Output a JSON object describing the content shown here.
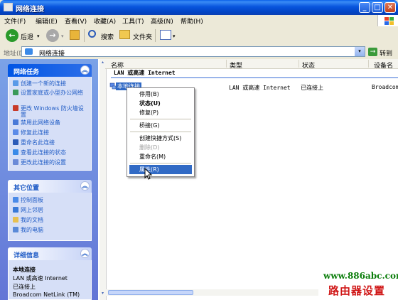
{
  "window": {
    "title": "网络连接"
  },
  "menu": [
    "文件(F)",
    "编辑(E)",
    "查看(V)",
    "收藏(A)",
    "工具(T)",
    "高级(N)",
    "帮助(H)"
  ],
  "toolbar": {
    "back": "后退",
    "search": "搜索",
    "folders": "文件夹"
  },
  "address": {
    "label": "地址(D)",
    "value": "网络连接",
    "go": "转到"
  },
  "task_pane": {
    "network_tasks": {
      "title": "网络任务",
      "items": [
        "创建一个新的连接",
        "设置家庭或小型办公网络",
        "更改 Windows 防火墙设置",
        "禁用此网络设备",
        "修复此连接",
        "重命名此连接",
        "查看此连接的状态",
        "更改此连接的设置"
      ]
    },
    "other_places": {
      "title": "其它位置",
      "items": [
        "控制面板",
        "网上邻居",
        "我的文档",
        "我的电脑"
      ]
    },
    "details": {
      "title": "详细信息",
      "lines": [
        "本地连接",
        "LAN 或高速 Internet",
        "已连接上",
        "Broadcom NetLink (TM)"
      ]
    }
  },
  "columns": [
    "名称",
    "类型",
    "状态",
    "设备名"
  ],
  "group_header": "LAN 或高速 Internet",
  "connection": {
    "name": "本地连接",
    "type": "LAN 或高速 Internet",
    "status": "已连接上",
    "device": "Broadcom"
  },
  "context_menu": [
    {
      "label": "停用(B)"
    },
    {
      "label": "状态(U)",
      "bold": true
    },
    {
      "label": "修复(P)"
    },
    {
      "separator": true
    },
    {
      "label": "桥接(G)"
    },
    {
      "separator": true
    },
    {
      "label": "创建快捷方式(S)"
    },
    {
      "label": "删除(D)",
      "disabled": true
    },
    {
      "label": "重命名(M)"
    },
    {
      "separator": true
    },
    {
      "label": "属性(R)",
      "highlighted": true
    }
  ],
  "watermark": {
    "url": "www.886abc.com",
    "text": "路由器设置"
  },
  "colors": {
    "titlebar": "#0855dd",
    "taskpane": "#6375d6",
    "selection": "#316ac5",
    "link": "#215dc6"
  }
}
